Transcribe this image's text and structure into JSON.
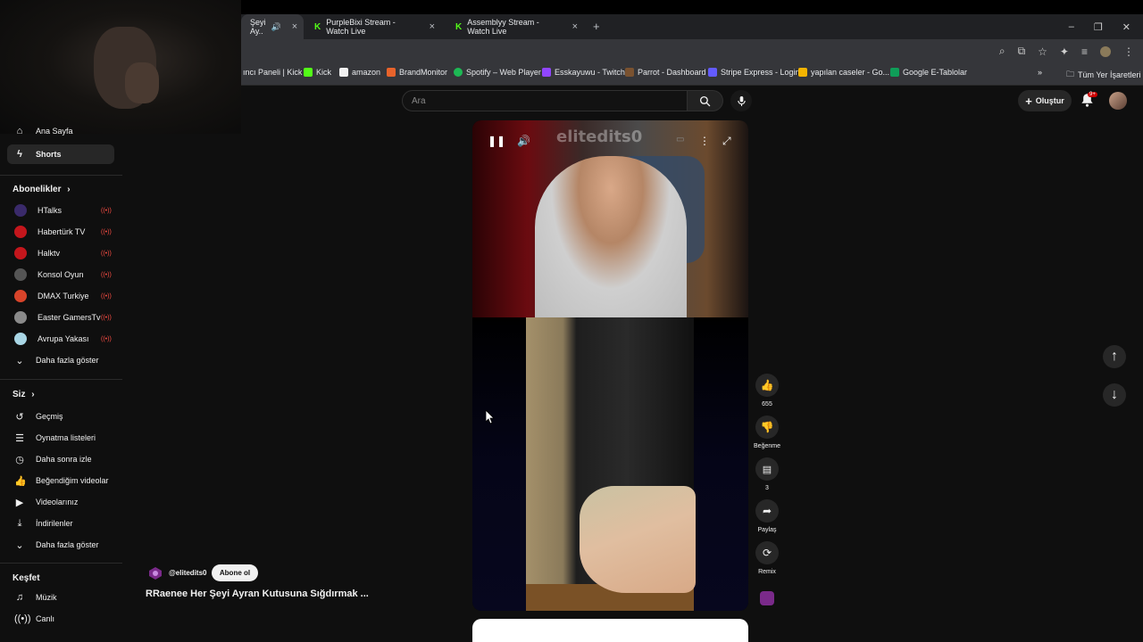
{
  "browser": {
    "tabs": [
      {
        "label": "Şeyi Ay..",
        "active": true
      },
      {
        "label": "PurpleBixi Stream - Watch Live",
        "active": false
      },
      {
        "label": "Assemblyy Stream - Watch Live",
        "active": false
      }
    ],
    "bookmarks": [
      {
        "label": "ıncı Paneli | Kick",
        "color": "#53fc18"
      },
      {
        "label": "Kick",
        "color": "#53fc18"
      },
      {
        "label": "amazon",
        "color": "#f1f1f1"
      },
      {
        "label": "BrandMonitor",
        "color": "#e8632b"
      },
      {
        "label": "Spotify – Web Player",
        "color": "#1db954"
      },
      {
        "label": "Esskayuwu - Twitch",
        "color": "#9146ff"
      },
      {
        "label": "Parrot - Dashboard",
        "color": "#7a5230"
      },
      {
        "label": "Stripe Express - Login",
        "color": "#635bff"
      },
      {
        "label": "yapılan caseler - Go...",
        "color": "#f4b400"
      },
      {
        "label": "Google E-Tablolar",
        "color": "#0f9d58"
      }
    ],
    "all_bookmarks": "Tüm Yer İşaretleri"
  },
  "header": {
    "search_placeholder": "Ara",
    "create_label": "Oluştur",
    "notif_count": "9+"
  },
  "sidebar": {
    "partial_item": "Ana Sayfa",
    "shorts": "Shorts",
    "subs_heading": "Abonelikler",
    "subscriptions": [
      {
        "name": "HTalks",
        "color": "#3a2a6a"
      },
      {
        "name": "Habertürk TV",
        "color": "#c4161c"
      },
      {
        "name": "Halktv",
        "color": "#c4161c"
      },
      {
        "name": "Konsol Oyun",
        "color": "#555555"
      },
      {
        "name": "DMAX Turkiye",
        "color": "#d8442a"
      },
      {
        "name": "Easter GamersTv",
        "color": "#8a8a8a"
      },
      {
        "name": "Avrupa Yakası",
        "color": "#a9d6e5"
      }
    ],
    "show_more_1": "Daha fazla göster",
    "you_heading": "Siz",
    "you_items": [
      {
        "label": "Geçmiş",
        "icon": "history-icon"
      },
      {
        "label": "Oynatma listeleri",
        "icon": "playlist-icon"
      },
      {
        "label": "Daha sonra izle",
        "icon": "clock-icon"
      },
      {
        "label": "Beğendiğim videolar",
        "icon": "thumbs-up-icon"
      },
      {
        "label": "Videolarınız",
        "icon": "video-icon"
      },
      {
        "label": "İndirilenler",
        "icon": "download-icon"
      }
    ],
    "show_more_2": "Daha fazla göster",
    "explore_heading": "Keşfet",
    "explore_items": [
      {
        "label": "Müzik",
        "icon": "music-icon"
      },
      {
        "label": "Canlı",
        "icon": "live-icon"
      }
    ]
  },
  "video": {
    "watermark": "elitedits0",
    "channel": "@elitedits0",
    "subscribe_label": "Abone ol",
    "title": "RRaenee Her Şeyi Ayran Kutusuna Sığdırmak ..."
  },
  "actions": {
    "likes": "655",
    "dislike_label": "Beğenme",
    "comments": "3",
    "share_label": "Paylaş",
    "remix_label": "Remix"
  }
}
